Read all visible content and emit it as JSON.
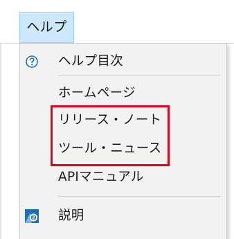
{
  "menubar": {
    "menu_title": "ヘルプ"
  },
  "menu": {
    "items": [
      {
        "label": "ヘルプ目次",
        "icon": "help-circle-icon"
      },
      {
        "label": "ホームページ"
      },
      {
        "label": "リリース・ノート"
      },
      {
        "label": "ツール・ニュース"
      },
      {
        "label": "APIマニュアル"
      },
      {
        "label": "説明",
        "icon": "app-info-icon"
      }
    ]
  },
  "colors": {
    "menu_title_highlight": "#cce8ff",
    "menu_background": "#f2f2f2",
    "annotation_box": "#e2001a",
    "help_icon_blue": "#1a6fc4",
    "info_icon_blue": "#1f6fb5"
  }
}
